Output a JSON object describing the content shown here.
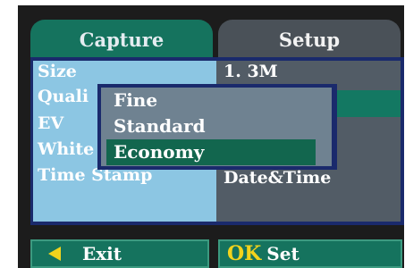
{
  "tabs": {
    "capture": "Capture",
    "setup": "Setup"
  },
  "menu": {
    "labels": [
      "Size",
      "Quali",
      "EV",
      "White",
      "Time Stamp"
    ],
    "values": [
      "1. 3M",
      "",
      "",
      "",
      "Date&Time"
    ]
  },
  "popup": {
    "options": [
      "Fine",
      "Standard",
      "Economy"
    ],
    "selected": "Economy"
  },
  "footer": {
    "exit_label": "Exit",
    "ok_label": "OK",
    "set_label": "Set"
  },
  "colors": {
    "tab_active": "#15735e",
    "tab_inactive": "#4a5158",
    "highlight": "#12664e",
    "accent": "#f2d31c"
  }
}
